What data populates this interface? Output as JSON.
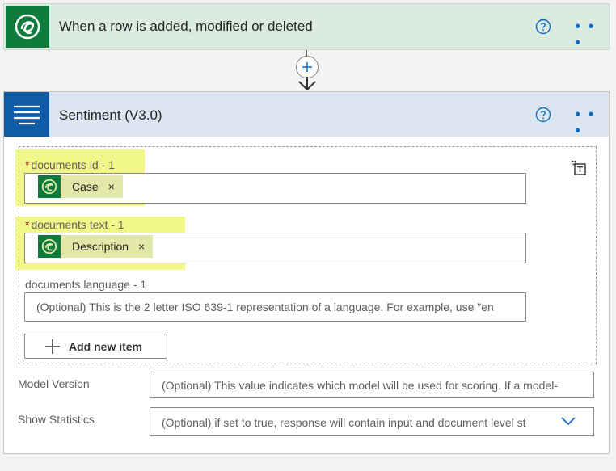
{
  "trigger": {
    "title": "When a row is added, modified or deleted",
    "icon": "dataverse-icon",
    "help_icon": "help-circle-icon",
    "more": "• • •"
  },
  "connector": {
    "icon": "plus-icon"
  },
  "action": {
    "title": "Sentiment (V3.0)",
    "icon": "text-lines-icon",
    "help_icon": "help-circle-icon",
    "more": "• • •",
    "documents": {
      "id_label": "documents id - 1",
      "id_token": "Case",
      "text_label": "documents text - 1",
      "text_token": "Description",
      "language_label": "documents language - 1",
      "language_placeholder": "(Optional) This is the 2 letter ISO 639-1 representation of a language. For example, use \"en",
      "required_mark": "*",
      "token_remove": "×",
      "add_item_label": "Add new item"
    },
    "model_version": {
      "label": "Model Version",
      "placeholder": "(Optional) This value indicates which model will be used for scoring. If a model-"
    },
    "show_statistics": {
      "label": "Show Statistics",
      "placeholder": "(Optional) if set to true, response will contain input and document level st"
    }
  },
  "colors": {
    "trigger_accent": "#0f7b3c",
    "action_accent": "#0f5ba8",
    "link_blue": "#0f6cbd",
    "highlight": "#e6f028"
  }
}
